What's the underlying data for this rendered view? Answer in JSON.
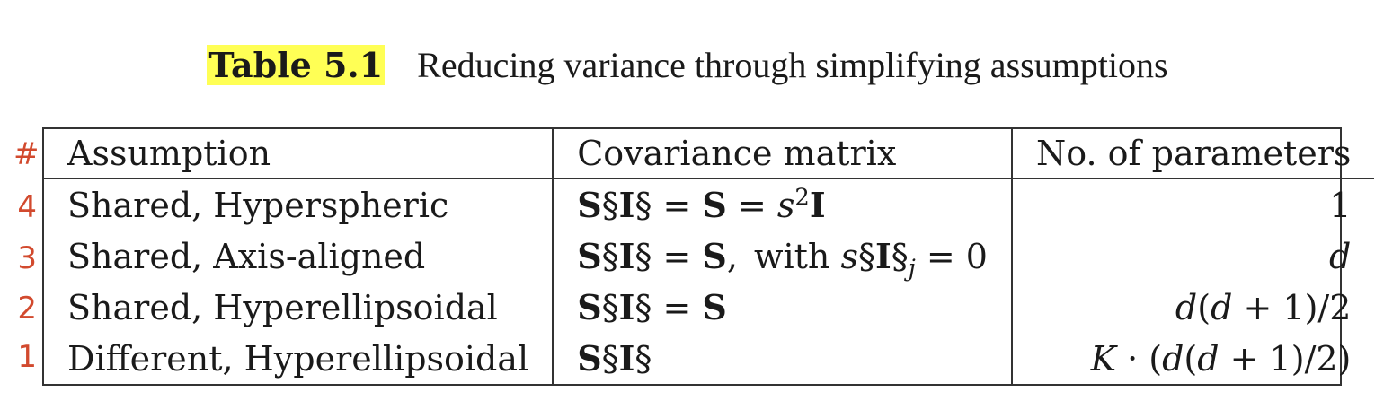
{
  "caption": {
    "label": "Table 5.1",
    "title": "Reducing variance through simplifying assumptions"
  },
  "row_numbers": {
    "header": "#",
    "rows": [
      "4",
      "3",
      "2",
      "1"
    ]
  },
  "table": {
    "headers": [
      "Assumption",
      "Covariance matrix",
      "No. of parameters"
    ],
    "rows": [
      {
        "assumption": "Shared, Hyperspheric",
        "covariance": "Sᵢ = S = s²I",
        "params": "1"
      },
      {
        "assumption": "Shared, Axis-aligned",
        "covariance": "Sᵢ = S, with sᵢⱼ = 0",
        "params": "d"
      },
      {
        "assumption": "Shared, Hyperellipsoidal",
        "covariance": "Sᵢ = S",
        "params": "d(d + 1)/2"
      },
      {
        "assumption": "Different, Hyperellipsoidal",
        "covariance": "Sᵢ",
        "params": "K · (d(d + 1)/2)"
      }
    ]
  },
  "colors": {
    "highlight": "#ffff55",
    "row_number": "#d24a2e",
    "border": "#333333"
  }
}
